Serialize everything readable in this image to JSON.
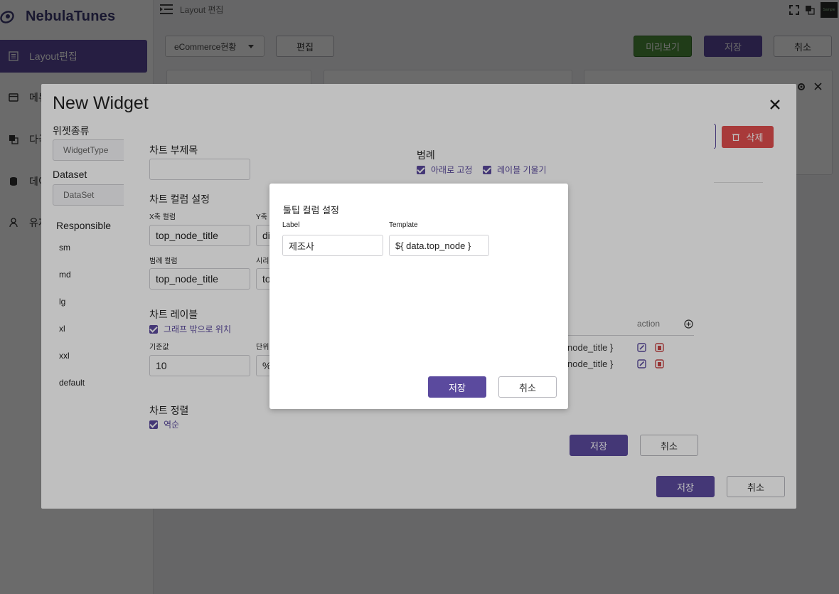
{
  "app": {
    "name": "NebulaTunes"
  },
  "sidebar": {
    "items": [
      {
        "label": "Layout편집",
        "active": true
      },
      {
        "label": "메뉴"
      },
      {
        "label": "다국"
      },
      {
        "label": "데이"
      },
      {
        "label": "유저"
      }
    ]
  },
  "topbar": {
    "breadcrumb": "Layout 편집",
    "avatar_text": "Sample"
  },
  "toolbar": {
    "dashboard_select": "eCommerce현황",
    "edit_label": "편집",
    "preview_label": "미리보기",
    "save_label": "저장",
    "cancel_label": "취소"
  },
  "widget_modal": {
    "title": "New Widget",
    "widget_type_label": "위젯종류",
    "widget_type_placeholder": "WidgetType",
    "dataset_label": "Dataset",
    "dataset_placeholder": "DataSet",
    "responsible_label": "Responsible",
    "responsible_items": [
      "sm",
      "md",
      "lg",
      "xl",
      "xxl",
      "default"
    ],
    "delete_label": "삭제",
    "save_label": "저장",
    "cancel_label": "취소"
  },
  "chart_modal": {
    "subtitle_label": "차트 부제목",
    "subtitle_value": "",
    "column_settings_label": "차트 컬럼 설정",
    "x_column_label": "X축 컬럼",
    "x_column_value": "top_node_title",
    "y_column_label": "Y축 컬",
    "y_column_value": "di",
    "legend_column_label": "범례 컬럼",
    "legend_column_value": "top_node_title",
    "series_column_label": "시리",
    "series_column_value": "to",
    "chart_label_label": "차트 레이블",
    "outside_graph_label": "그래프 밖으로 위치",
    "base_value_label": "기준값",
    "base_value": "10",
    "unit_label": "단위",
    "unit_value": "%",
    "sort_label": "차트 정렬",
    "reverse_label": "역순",
    "legend_label": "범례",
    "fix_bottom_label": "아래로 고정",
    "tilt_label_label": "레이블 기울기",
    "action_header": "action",
    "rows": [
      "node_title }",
      "node_title }"
    ],
    "save_label": "저장",
    "cancel_label": "취소"
  },
  "tooltip_modal": {
    "title": "툴팁 컬럼 설정",
    "label_header": "Label",
    "template_header": "Template",
    "label_value": "제조사",
    "template_value": "${ data.top_node }",
    "save_label": "저장",
    "cancel_label": "취소"
  },
  "colors": {
    "primary": "#5b4a9e",
    "danger": "#e04e4e",
    "preview": "#4d8f3a"
  }
}
